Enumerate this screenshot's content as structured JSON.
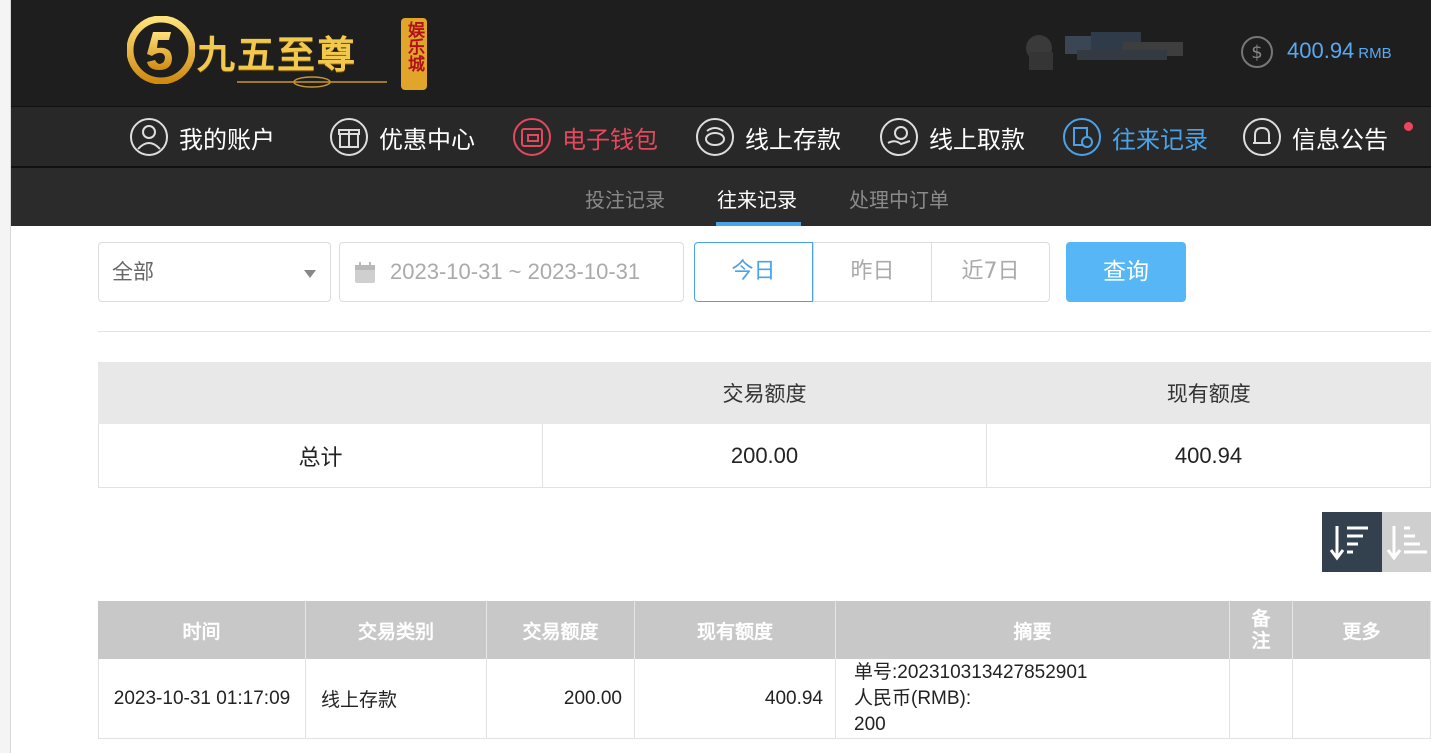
{
  "brand": {
    "name": "九五至尊",
    "badge": "娱乐城"
  },
  "account": {
    "balance": "400.94",
    "currency": "RMB"
  },
  "nav": [
    {
      "label": "我的账户",
      "icon": "user-icon"
    },
    {
      "label": "优惠中心",
      "icon": "gift-icon"
    },
    {
      "label": "电子钱包",
      "icon": "wallet-icon"
    },
    {
      "label": "线上存款",
      "icon": "deposit-icon"
    },
    {
      "label": "线上取款",
      "icon": "withdraw-icon"
    },
    {
      "label": "往来记录",
      "icon": "records-icon"
    },
    {
      "label": "信息公告",
      "icon": "bell-icon"
    }
  ],
  "subtabs": [
    "投注记录",
    "往来记录",
    "处理中订单"
  ],
  "filters": {
    "type_selected": "全部",
    "date_range": "2023-10-31 ~ 2023-10-31",
    "quick": [
      "今日",
      "昨日",
      "近7日"
    ],
    "query_label": "查询"
  },
  "summary": {
    "headers": [
      "",
      "交易额度",
      "现有额度"
    ],
    "row": [
      "总计",
      "200.00",
      "400.94"
    ]
  },
  "records": {
    "headers": [
      "时间",
      "交易类别",
      "交易额度",
      "现有额度",
      "摘要",
      "备注",
      "更多"
    ],
    "rows": [
      {
        "time": "2023-10-31 01:17:09",
        "type": "线上存款",
        "amount": "200.00",
        "balance": "400.94",
        "summary_line1": "单号:202310313427852901",
        "summary_line2": "人民币(RMB):",
        "summary_line3": "200",
        "remark": "",
        "more": ""
      }
    ]
  },
  "colors": {
    "accent_blue": "#4aa3e8",
    "accent_red": "#e5485c",
    "header_bg": "#1e1e1e",
    "query_button": "#57b6f5"
  }
}
